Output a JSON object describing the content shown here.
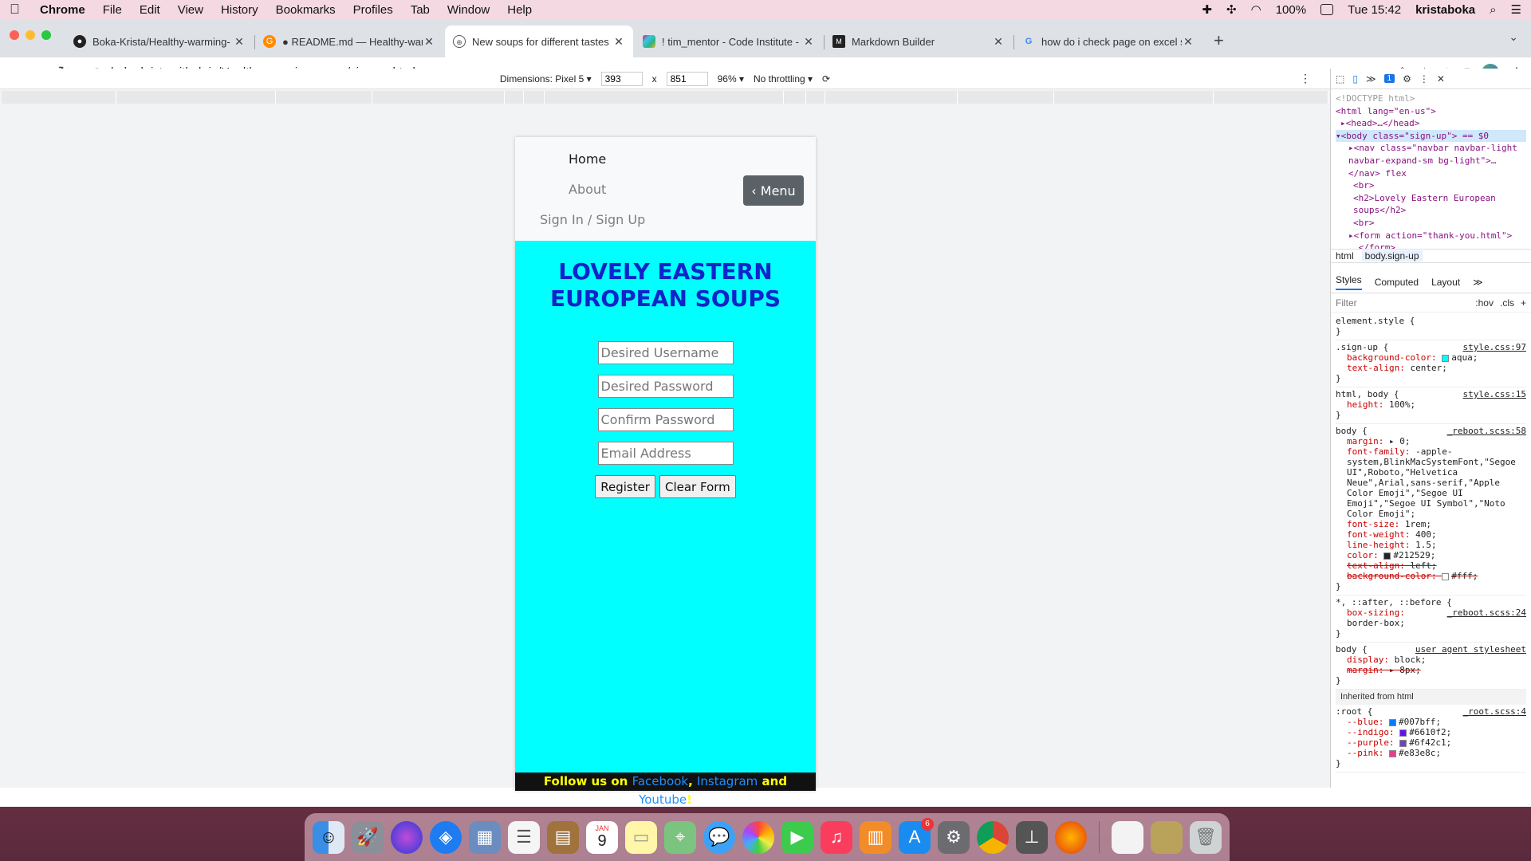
{
  "menubar": {
    "app": "Chrome",
    "items": [
      "File",
      "Edit",
      "View",
      "History",
      "Bookmarks",
      "Profiles",
      "Tab",
      "Window",
      "Help"
    ],
    "battery": "100%",
    "clock": "Tue 15:42",
    "user": "kristaboka"
  },
  "tabs": [
    {
      "title": "Boka-Krista/Healthy-warming-",
      "icon": "github-icon"
    },
    {
      "title": "● README.md — Healthy-war",
      "icon": "gitpod-icon"
    },
    {
      "title": "New soups for different tastes",
      "icon": "globe-icon",
      "active": true
    },
    {
      "title": "! tim_mentor - Code Institute -",
      "icon": "slack-icon"
    },
    {
      "title": "Markdown Builder",
      "icon": "markdown-icon"
    },
    {
      "title": "how do i check page on excel s",
      "icon": "google-icon"
    }
  ],
  "address": {
    "url": "boka-krista.github.io/Healthy-warming-soups/sign-up.html"
  },
  "device_toolbar": {
    "dimensions": "Dimensions: Pixel 5 ▾",
    "width": "393",
    "height": "851",
    "zoom": "96% ▾",
    "throttle": "No throttling ▾",
    "x": "x"
  },
  "site": {
    "nav": {
      "home": "Home",
      "about": "About",
      "signin": "Sign In / Sign Up",
      "menu_button": "‹ Menu"
    },
    "heading": "LOVELY EASTERN EUROPEAN SOUPS",
    "form": {
      "username_placeholder": "Desired Username",
      "password_placeholder": "Desired Password",
      "confirm_placeholder": "Confirm Password",
      "email_placeholder": "Email Address",
      "register": "Register",
      "clear": "Clear Form"
    },
    "footer": {
      "prefix": "Follow us on ",
      "facebook": "Facebook",
      "comma": ", ",
      "instagram": "Instagram",
      "and": " and ",
      "youtube": "Youtube",
      "suffix": "!"
    }
  },
  "devtools": {
    "issues_badge": "1",
    "dom_lines": [
      "<!DOCTYPE html>",
      "<html lang=\"en-us\">",
      "▸<head>…</head>",
      "▾<body class=\"sign-up\"> == $0",
      "▸<nav class=\"navbar navbar-light navbar-expand-sm bg-light\">…</nav> flex",
      "<br>",
      "<h2>Lovely Eastern European soups</h2>",
      "<br>",
      "▸<form action=\"thank-you.html\">",
      "…</form>"
    ],
    "crumbs": [
      "html",
      "body.sign-up"
    ],
    "panes": [
      "Styles",
      "Computed",
      "Layout",
      "≫"
    ],
    "filter_placeholder": "Filter",
    "hov": ":hov",
    "cls": ".cls",
    "rules": [
      {
        "selector": "element.style {",
        "source": "",
        "props": []
      },
      {
        "selector": ".sign-up {",
        "source": "style.css:97",
        "props": [
          {
            "p": "background-color:",
            "v": "aqua;",
            "swatch": "#00ffff"
          },
          {
            "p": "text-align:",
            "v": "center;"
          }
        ]
      },
      {
        "selector": "html, body {",
        "source": "style.css:15",
        "props": [
          {
            "p": "height:",
            "v": "100%;"
          }
        ]
      },
      {
        "selector": "body {",
        "source": "_reboot.scss:58",
        "props": [
          {
            "p": "margin:",
            "v": "▸ 0;"
          },
          {
            "p": "font-family:",
            "v": "-apple-system,BlinkMacSystemFont,\"Segoe UI\",Roboto,\"Helvetica Neue\",Arial,sans-serif,\"Apple Color Emoji\",\"Segoe UI Emoji\",\"Segoe UI Symbol\",\"Noto Color Emoji\";"
          },
          {
            "p": "font-size:",
            "v": "1rem;"
          },
          {
            "p": "font-weight:",
            "v": "400;"
          },
          {
            "p": "line-height:",
            "v": "1.5;"
          },
          {
            "p": "color:",
            "v": "#212529;",
            "swatch": "#212529"
          },
          {
            "p": "text-align:",
            "v": "left;",
            "strike": true
          },
          {
            "p": "background-color:",
            "v": "#fff;",
            "swatch": "#ffffff",
            "strike": true
          }
        ]
      },
      {
        "selector": "*, ::after, ::before {",
        "source": "_reboot.scss:24",
        "props": [
          {
            "p": "box-sizing:",
            "v": "border-box;"
          }
        ]
      },
      {
        "selector": "body {",
        "source": "user agent stylesheet",
        "props": [
          {
            "p": "display:",
            "v": "block;"
          },
          {
            "p": "margin:",
            "v": "▸ 8px;",
            "strike": true
          }
        ]
      }
    ],
    "inherited": "Inherited from html",
    "root_rule": {
      "selector": ":root {",
      "source": "_root.scss:4",
      "props": [
        {
          "p": "--blue:",
          "v": "#007bff;",
          "swatch": "#007bff"
        },
        {
          "p": "--indigo:",
          "v": "#6610f2;",
          "swatch": "#6610f2"
        },
        {
          "p": "--purple:",
          "v": "#6f42c1;",
          "swatch": "#6f42c1"
        },
        {
          "p": "--pink:",
          "v": "#e83e8c;",
          "swatch": "#e83e8c"
        }
      ]
    }
  },
  "dock": {
    "calendar_month": "JAN",
    "calendar_day": "9",
    "appstore_badge": "6",
    "apps": [
      "finder-icon",
      "launchpad-icon",
      "siri-icon",
      "safari-icon",
      "preview-icon",
      "reminders-icon",
      "notes-brown-icon",
      "calendar-icon",
      "notes-icon",
      "maps-icon",
      "messages-icon",
      "photos-icon",
      "facetime-icon",
      "music-icon",
      "books-icon",
      "appstore-icon",
      "settings-icon",
      "chrome-icon",
      "terminal-icon",
      "firefox-icon",
      "files-icon",
      "image-icon",
      "trash-icon"
    ]
  },
  "colors": {
    "page_bg": "#00ffff",
    "heading": "#0f24c9",
    "footer_link": "#1e90ff",
    "footer_text": "#ffff00"
  }
}
